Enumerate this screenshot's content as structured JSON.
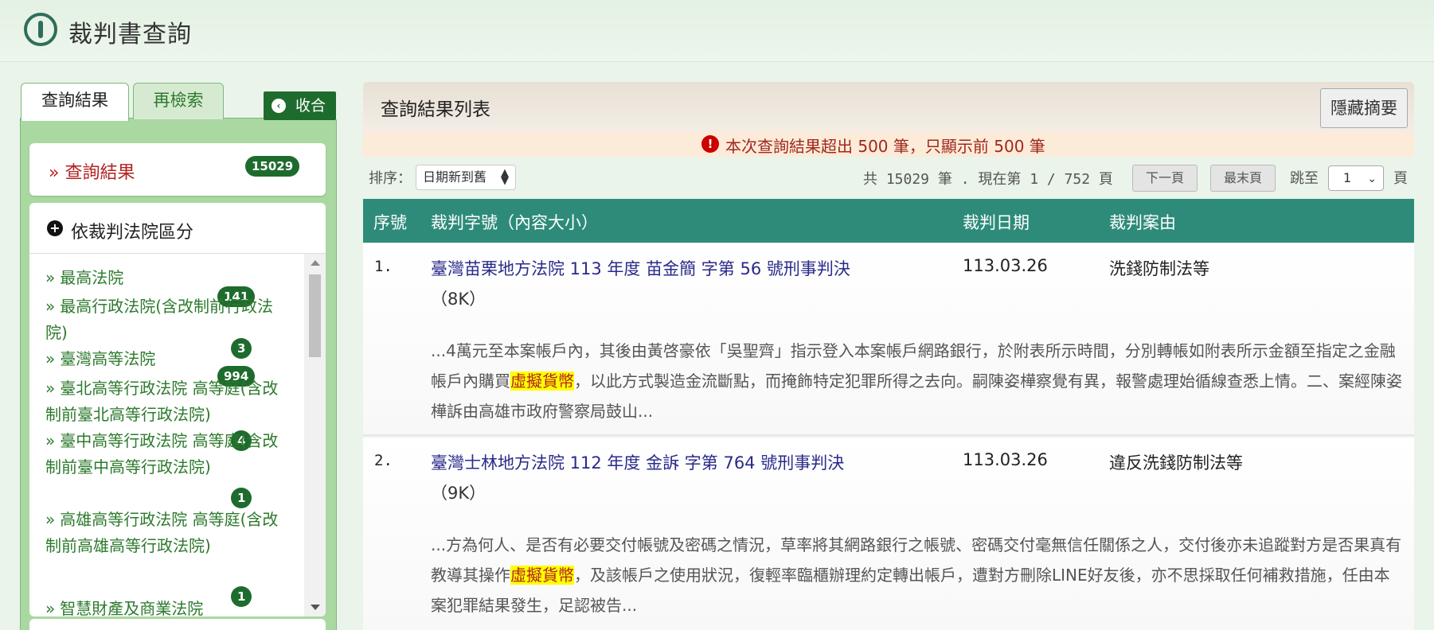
{
  "header": {
    "app_title": "裁判書查詢"
  },
  "left": {
    "tabs": [
      "查詢結果",
      "再檢索"
    ],
    "collapse_label": "收合",
    "results_card": {
      "label": "» 查詢結果",
      "count": "15029"
    },
    "court_section": {
      "title": "依裁判法院區分",
      "items": [
        {
          "label": "最高法院",
          "count": "141"
        },
        {
          "label": "最高行政法院(含改制前行政法院)",
          "count": "3"
        },
        {
          "label": "臺灣高等法院",
          "count": "994"
        },
        {
          "label": "臺北高等行政法院 高等庭(含改制前臺北高等行政法院)",
          "count": "4"
        },
        {
          "label": "臺中高等行政法院 高等庭(含改制前臺中高等行政法院)",
          "count": "1"
        },
        {
          "label": "高雄高等行政法院 高等庭(含改制前高雄高等行政法院)",
          "count": "1"
        },
        {
          "label": "智慧財產及商業法院",
          "count": ""
        }
      ]
    }
  },
  "main": {
    "list_title": "查詢結果列表",
    "hide_summary_label": "隱藏摘要",
    "warning": "本次查詢結果超出 500 筆，只顯示前 500 筆",
    "sort_label": "排序：",
    "sort_value": "日期新到舊",
    "paging_info": "共 15029 筆 . 現在第 1 / 752 頁",
    "next_page_label": "下一頁",
    "last_page_label": "最末頁",
    "jump_label": "跳至",
    "jump_value": "1",
    "page_suffix": "頁",
    "columns": [
      "序號",
      "裁判字號（內容大小）",
      "裁判日期",
      "裁判案由"
    ],
    "rows": [
      {
        "no": "1.",
        "case": "臺灣苗栗地方法院 113 年度 苗金簡 字第 56 號刑事判決",
        "size": "（8K）",
        "date": "113.03.26",
        "reason": "洗錢防制法等",
        "summary_pre": "...4萬元至本案帳戶內，其後由黃啓豪依「吳聖齊」指示登入本案帳戶網路銀行，於附表所示時間，分別轉帳如附表所示金額至指定之金融帳戶內購買",
        "summary_hl": "虛擬貨幣",
        "summary_post": "，以此方式製造金流斷點，而掩飾特定犯罪所得之去向。嗣陳姿樺察覺有異，報警處理始循線查悉上情。二、案經陳姿樺訴由高雄市政府警察局鼓山..."
      },
      {
        "no": "2.",
        "case": "臺灣士林地方法院 112 年度 金訴 字第 764 號刑事判決",
        "size": "（9K）",
        "date": "113.03.26",
        "reason": "違反洗錢防制法等",
        "summary_pre": "...方為何人、是否有必要交付帳號及密碼之情況，草率將其網路銀行之帳號、密碼交付毫無信任關係之人，交付後亦未追蹤對方是否果真有教導其操作",
        "summary_hl": "虛擬貨幣",
        "summary_post": "，及該帳戶之使用狀況，復輕率臨櫃辦理約定轉出帳戶，遭對方刪除LINE好友後，亦不思採取任何補救措施，任由本案犯罪結果發生，足認被告..."
      }
    ]
  },
  "colors": {
    "brand_green": "#1e6b2e",
    "table_header": "#2e8b7a",
    "highlight": "#ffff00",
    "warning_text": "#a0281e"
  }
}
